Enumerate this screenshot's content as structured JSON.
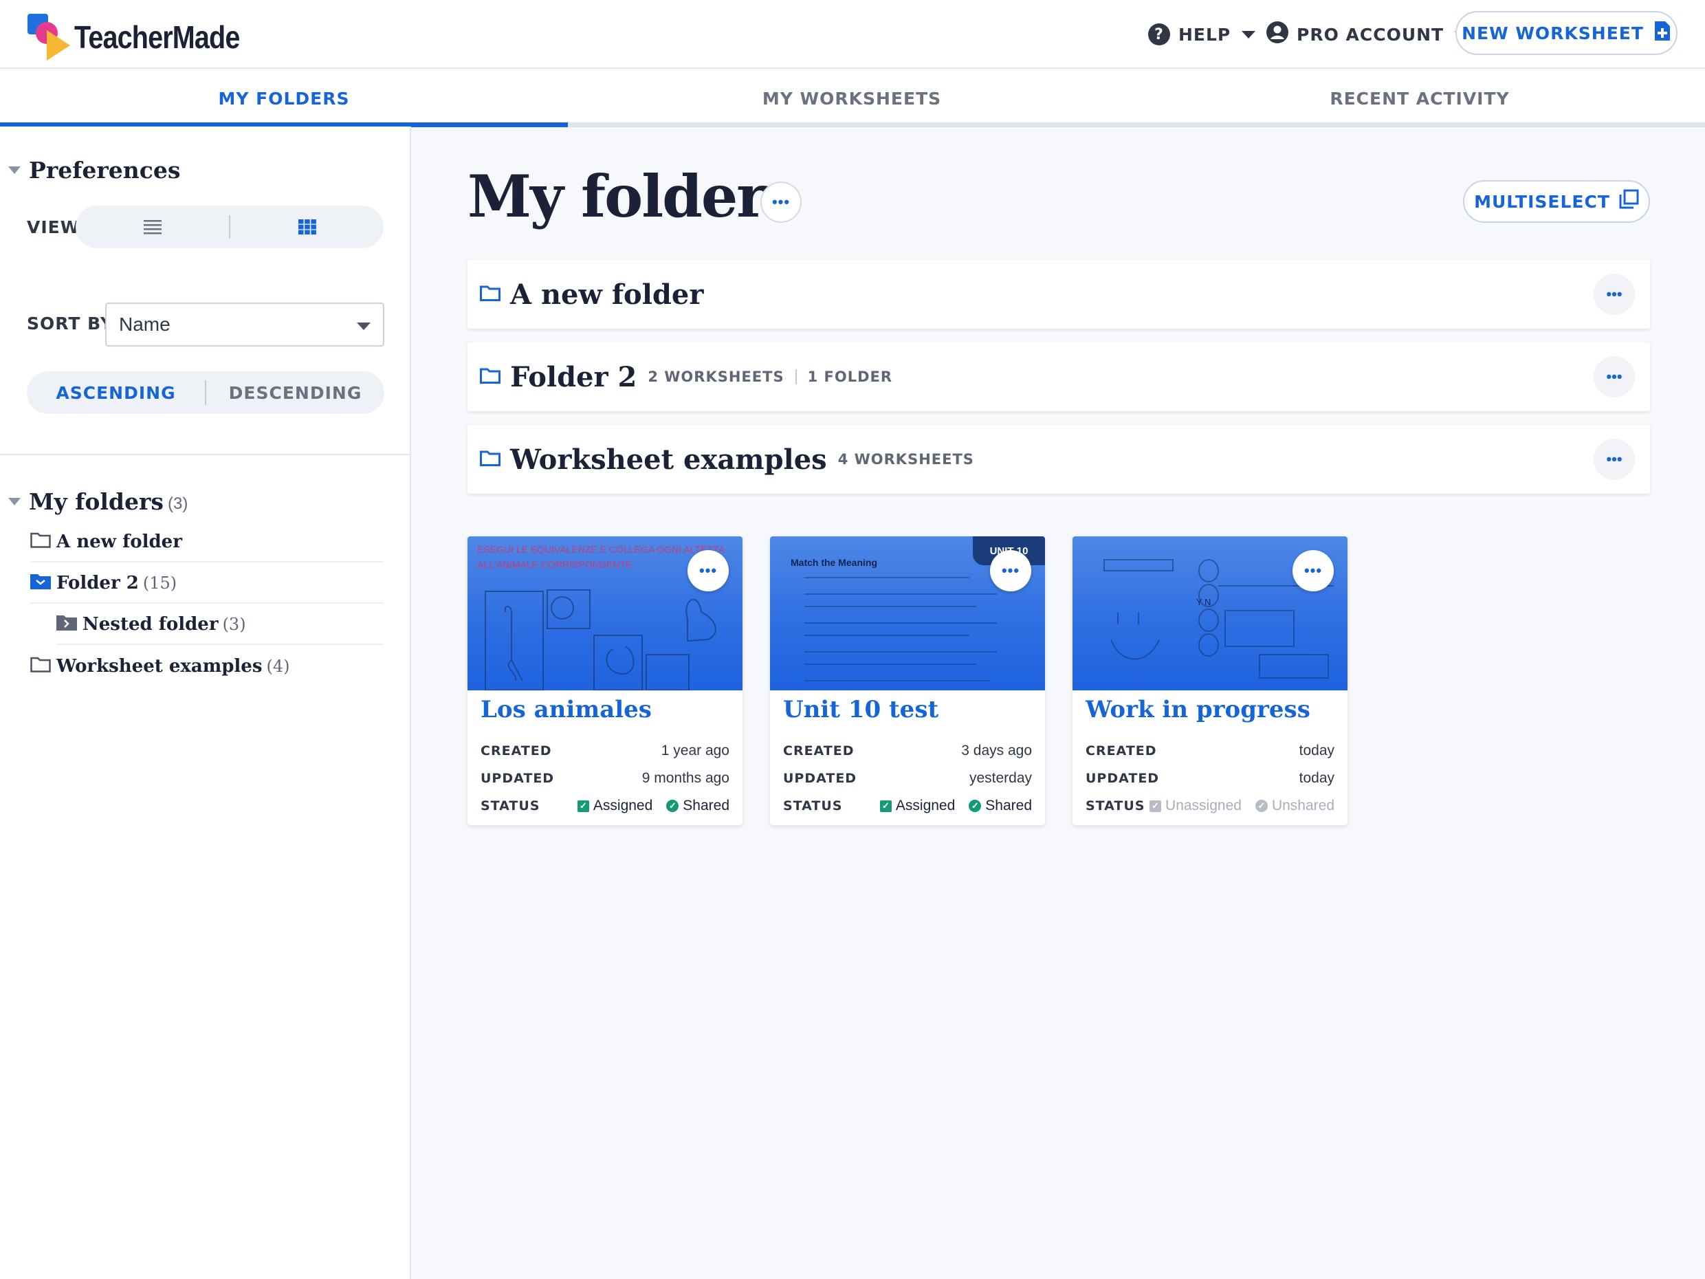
{
  "brand": {
    "name": "TeacherMade"
  },
  "header": {
    "help_label": "HELP",
    "account_label": "PRO ACCOUNT",
    "new_worksheet_label": "NEW WORKSHEET"
  },
  "tabs": [
    {
      "label": "MY FOLDERS",
      "active": true
    },
    {
      "label": "MY WORKSHEETS",
      "active": false
    },
    {
      "label": "RECENT ACTIVITY",
      "active": false
    }
  ],
  "preferences": {
    "title": "Preferences",
    "view_label": "VIEW",
    "view_selected": "grid",
    "sort_label": "SORT BY",
    "sort_value": "Name",
    "ascending_label": "ASCENDING",
    "descending_label": "DESCENDING",
    "order_selected": "ascending"
  },
  "tree": {
    "title": "My folders",
    "count": "(3)",
    "items": [
      {
        "label": "A new folder",
        "count": ""
      },
      {
        "label": "Folder 2",
        "count": "(15)"
      },
      {
        "label": "Nested folder",
        "count": "(3)"
      },
      {
        "label": "Worksheet examples",
        "count": "(4)"
      }
    ]
  },
  "main": {
    "title": "My folders",
    "multiselect_label": "MULTISELECT",
    "folders": [
      {
        "name": "A new folder",
        "worksheets": "",
        "folders": ""
      },
      {
        "name": "Folder 2",
        "worksheets": "2 WORKSHEETS",
        "folders": "1 FOLDER"
      },
      {
        "name": "Worksheet examples",
        "worksheets": "4 WORKSHEETS",
        "folders": ""
      }
    ],
    "cards": [
      {
        "title": "Los animales",
        "created_label": "CREATED",
        "created": "1 year ago",
        "updated_label": "UPDATED",
        "updated": "9 months ago",
        "status_label": "STATUS",
        "assigned": "Assigned",
        "shared": "Shared",
        "thumb_text_1": "ESEGUI LE EQUIVALENZE E COLLEGA OGNI ALTEZZA",
        "thumb_text_2": "ALL'ANIMALE CORRISPONDENTE"
      },
      {
        "title": "Unit 10 test",
        "created_label": "CREATED",
        "created": "3 days ago",
        "updated_label": "UPDATED",
        "updated": "yesterday",
        "status_label": "STATUS",
        "assigned": "Assigned",
        "shared": "Shared",
        "thumb_badge": "UNIT 10",
        "thumb_heading": "Match the Meaning"
      },
      {
        "title": "Work in progress",
        "created_label": "CREATED",
        "created": "today",
        "updated_label": "UPDATED",
        "updated": "today",
        "status_label": "STATUS",
        "assigned": "Unassigned",
        "shared": "Unshared",
        "thumb_yn": "Y  N"
      }
    ]
  },
  "colors": {
    "accent": "#1565d8",
    "ok_green": "#159a78",
    "ink": "#1b2238"
  }
}
